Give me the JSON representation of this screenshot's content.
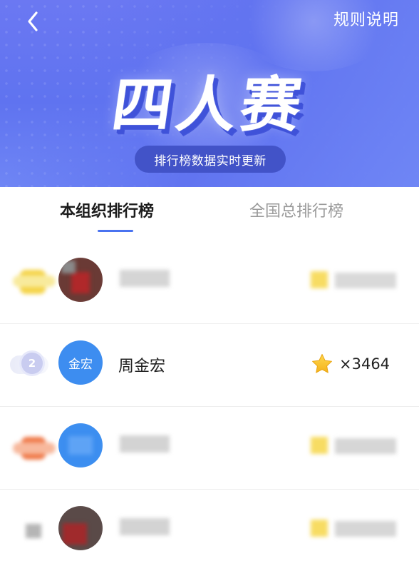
{
  "header": {
    "back_icon": "chevron-left-icon",
    "rules_label": "规则说明",
    "title": "四人赛",
    "update_note": "排行榜数据实时更新",
    "colors": {
      "banner": "#6b78f2",
      "pill": "#4253c8"
    }
  },
  "tabs": [
    {
      "label": "本组织排行榜",
      "active": true
    },
    {
      "label": "全国总排行榜",
      "active": false
    }
  ],
  "accent": "#4a73f0",
  "rankings": [
    {
      "rank_icon": "gold-medal-icon",
      "name": "",
      "score": "",
      "blurred": true
    },
    {
      "rank": "2",
      "avatar_text": "金宏",
      "name": "周金宏",
      "score": "×3464",
      "star_icon": "star-icon",
      "blurred": false
    },
    {
      "rank_icon": "bronze-medal-icon",
      "name": "",
      "score": "",
      "blurred": true
    },
    {
      "rank": "4",
      "name": "",
      "score": "",
      "blurred": true
    }
  ]
}
